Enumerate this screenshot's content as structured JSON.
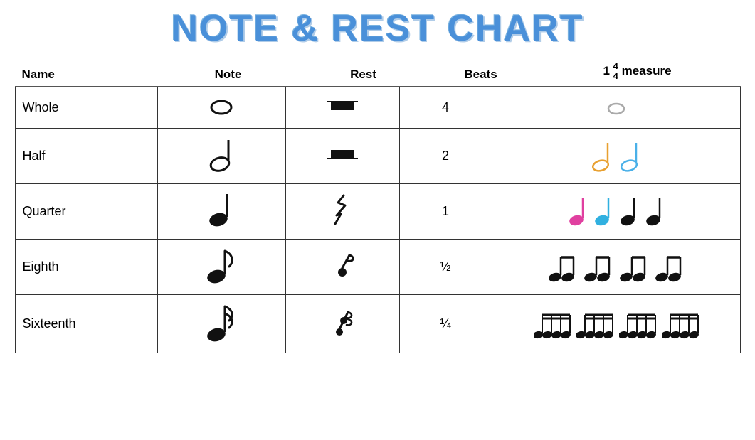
{
  "title": "note & rest chart",
  "header": {
    "name": "Name",
    "note": "Note",
    "rest": "Rest",
    "beats": "Beats",
    "one": "1",
    "time_top": "4",
    "time_bottom": "4",
    "measure": "measure"
  },
  "rows": [
    {
      "name": "Whole",
      "beats": "4"
    },
    {
      "name": "Half",
      "beats": "2"
    },
    {
      "name": "Quarter",
      "beats": "1"
    },
    {
      "name": "Eighth",
      "beats": "½"
    },
    {
      "name": "Sixteenth",
      "beats": "¼"
    }
  ]
}
